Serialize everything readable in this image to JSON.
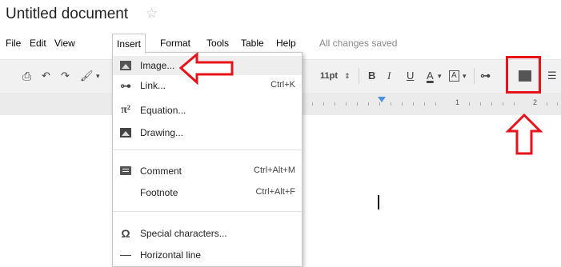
{
  "title": {
    "text": "Untitled document",
    "star_icon": "star-outline-icon"
  },
  "menubar": {
    "items": [
      "File",
      "Edit",
      "View",
      "Insert",
      "Format",
      "Tools",
      "Table",
      "Help"
    ],
    "active": "Insert",
    "status": "All changes saved"
  },
  "toolbar": {
    "font_size": "11pt",
    "bold": "B",
    "italic": "I",
    "underline": "U",
    "text_color": "A",
    "highlight": "A",
    "icons": [
      "print-icon",
      "undo-icon",
      "redo-icon",
      "paint-format-icon",
      "link-icon",
      "insert-image-icon",
      "numbered-list-icon"
    ]
  },
  "ruler": {
    "labels": [
      "1",
      "2"
    ]
  },
  "insert_menu": {
    "items": [
      {
        "label": "Image...",
        "shortcut": "",
        "icon": "image-icon"
      },
      {
        "label": "Link...",
        "shortcut": "Ctrl+K",
        "icon": "link-icon"
      },
      {
        "label": "Equation...",
        "shortcut": "",
        "icon": "pi-icon",
        "icon_text": "π²"
      },
      {
        "label": "Drawing...",
        "shortcut": "",
        "icon": "drawing-icon"
      },
      {
        "label": "Comment",
        "shortcut": "Ctrl+Alt+M",
        "icon": "comment-icon"
      },
      {
        "label": "Footnote",
        "shortcut": "Ctrl+Alt+F",
        "icon": ""
      },
      {
        "label": "Special characters...",
        "shortcut": "",
        "icon": "omega-icon",
        "icon_text": "Ω"
      },
      {
        "label": "Horizontal line",
        "shortcut": "",
        "icon": "horizontal-line-icon"
      }
    ]
  },
  "colors": {
    "annotation_red": "#e8131a",
    "accent_blue": "#4a90e2"
  }
}
